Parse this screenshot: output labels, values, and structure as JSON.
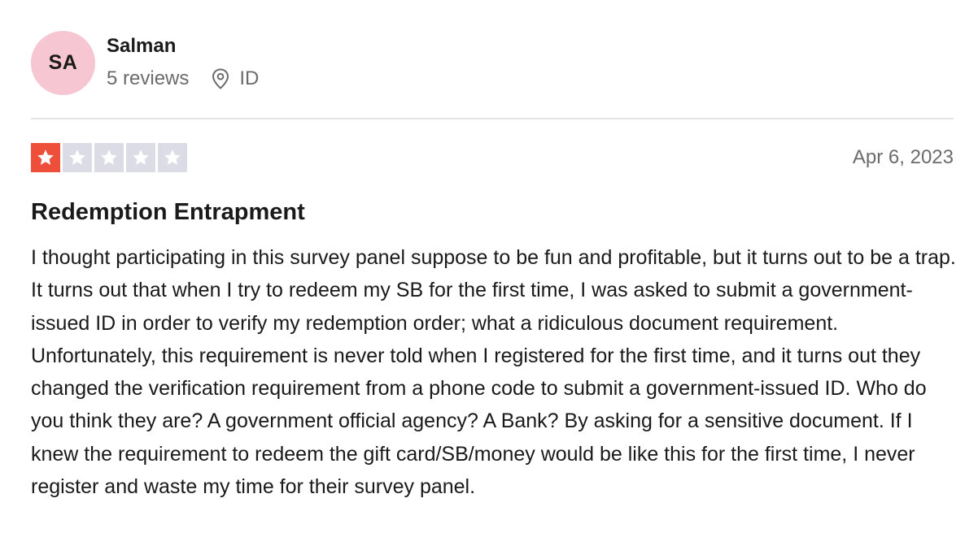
{
  "reviewer": {
    "initials": "SA",
    "name": "Salman",
    "reviews_count": "5 reviews",
    "country": "ID",
    "location_icon": "location-pin-icon"
  },
  "rating": {
    "value": 1,
    "max": 5,
    "filled_color": "#ee4f3a",
    "empty_color": "#dcdce6"
  },
  "review": {
    "date": "Apr 6, 2023",
    "title": "Redemption Entrapment",
    "body": "I thought participating in this survey panel suppose to be fun and profitable, but it turns out to be a trap. It turns out that when I try to redeem my SB for the first time, I was asked to submit a government-issued ID in order to verify my redemption order; what a ridiculous document requirement. Unfortunately, this requirement is never told when I registered for the first time, and it turns out they changed the verification requirement from a phone code to submit a government-issued ID. Who do you think they are? A government official agency? A Bank? By asking for a sensitive document. If I knew the requirement to redeem the gift card/SB/money would be like this for the first time, I never register and waste my time for their survey panel."
  },
  "colors": {
    "avatar_bg": "#f6c6d2",
    "muted_text": "#6b6b6b"
  }
}
